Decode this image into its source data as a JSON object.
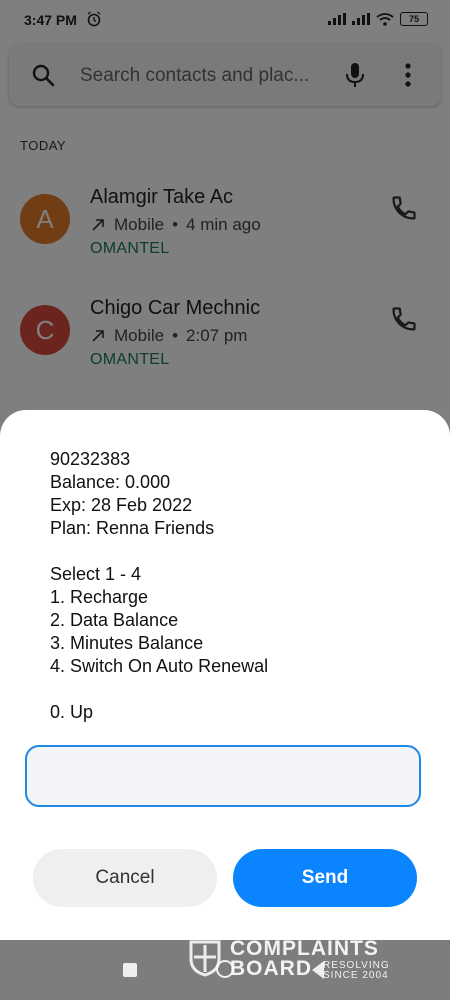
{
  "status_bar": {
    "time": "3:47 PM",
    "battery": "75",
    "icons": [
      "alarm-icon",
      "signal-icon",
      "signal-icon",
      "wifi-icon",
      "battery-icon"
    ]
  },
  "search": {
    "placeholder": "Search contacts and plac..."
  },
  "section_label": "TODAY",
  "calls": [
    {
      "initial": "A",
      "name": "Alamgir Take Ac",
      "direction": "outgoing",
      "type": "Mobile",
      "time": "4 min ago",
      "carrier": "OMANTEL",
      "avatar_color": "#e07b2a"
    },
    {
      "initial": "C",
      "name": "Chigo Car Mechnic",
      "direction": "outgoing",
      "type": "Mobile",
      "time": "2:07 pm",
      "carrier": "OMANTEL",
      "avatar_color": "#d84a3c"
    }
  ],
  "dialog": {
    "lines": [
      "90232383",
      "Balance: 0.000",
      "Exp: 28 Feb 2022",
      "Plan: Renna Friends",
      "",
      "Select 1 - 4",
      "1. Recharge",
      "2. Data Balance",
      "3. Minutes Balance",
      "4. Switch On Auto Renewal",
      "",
      "0. Up"
    ],
    "input_value": "",
    "cancel_label": "Cancel",
    "send_label": "Send"
  },
  "watermark": {
    "line1": "COMPLAINTS",
    "line2": "BOARD",
    "tagline1": "RESOLVING",
    "tagline2": "SINCE 2004"
  },
  "colors": {
    "accent": "#0a84ff",
    "carrier_green": "#1a7a56",
    "field_border": "#1e88e5"
  }
}
